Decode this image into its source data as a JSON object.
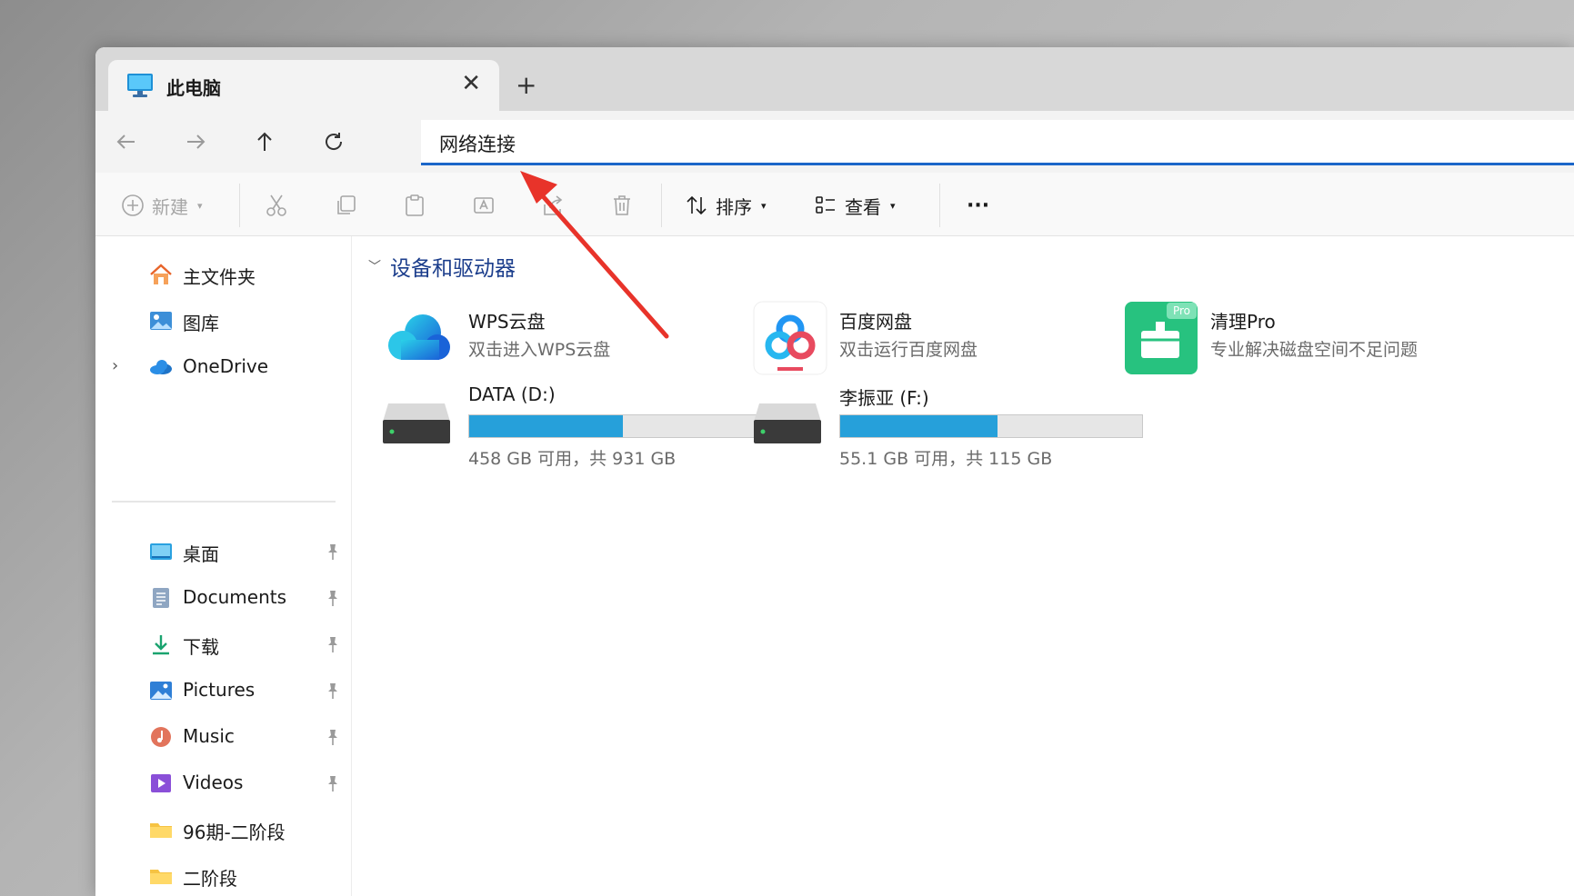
{
  "tab": {
    "title": "此电脑",
    "close": "✕",
    "new_tab": "+"
  },
  "address": {
    "value": "网络连接"
  },
  "commands": {
    "new_label": "新建",
    "sort_label": "排序",
    "view_label": "查看",
    "more_label": "···"
  },
  "sidebar": {
    "items": [
      {
        "label": "主文件夹",
        "icon": "home-icon"
      },
      {
        "label": "图库",
        "icon": "gallery-icon"
      },
      {
        "label": "OneDrive",
        "icon": "onedrive-icon"
      },
      {
        "label": "桌面",
        "icon": "desktop-icon"
      },
      {
        "label": "Documents",
        "icon": "documents-icon"
      },
      {
        "label": "下载",
        "icon": "download-icon"
      },
      {
        "label": "Pictures",
        "icon": "pictures-icon"
      },
      {
        "label": "Music",
        "icon": "music-icon"
      },
      {
        "label": "Videos",
        "icon": "videos-icon"
      },
      {
        "label": "96期-二阶段",
        "icon": "folder-icon"
      },
      {
        "label": "二阶段",
        "icon": "folder-icon"
      }
    ]
  },
  "content": {
    "group_title": "设备和驱动器",
    "apps": [
      {
        "name": "WPS云盘",
        "sub": "双击进入WPS云盘"
      },
      {
        "name": "百度网盘",
        "sub": "双击运行百度网盘"
      },
      {
        "name": "清理Pro",
        "sub": "专业解决磁盘空间不足问题",
        "badge": "Pro"
      }
    ],
    "drives": [
      {
        "name": "DATA (D:)",
        "sub": "458 GB 可用，共 931 GB",
        "used_fraction": 0.508
      },
      {
        "name": "李振亚 (F:)",
        "sub": "55.1 GB 可用，共 115 GB",
        "used_fraction": 0.521
      }
    ]
  },
  "colors": {
    "accent": "#1b66c9",
    "drive_fill": "#26a0da",
    "group_title": "#1c3e8c",
    "arrow": "#e8332a"
  }
}
